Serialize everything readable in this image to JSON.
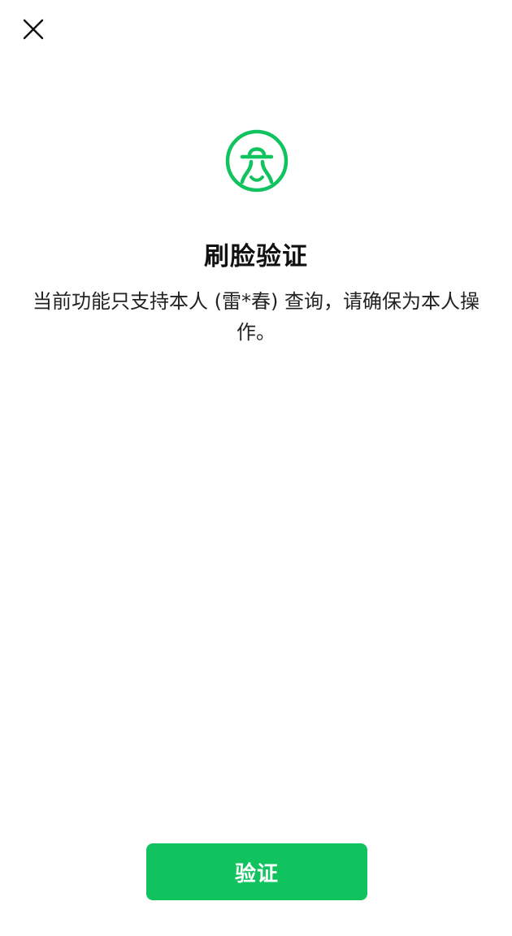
{
  "header": {
    "close_icon": "close-icon"
  },
  "logo": {
    "icon": "face-verification-logo-icon",
    "color": "#11c35f"
  },
  "main": {
    "title": "刷脸验证",
    "description": "当前功能只支持本人 (雷*春) 查询，请确保为本人操作。"
  },
  "footer": {
    "verify_label": "验证",
    "button_color": "#11c35f"
  }
}
